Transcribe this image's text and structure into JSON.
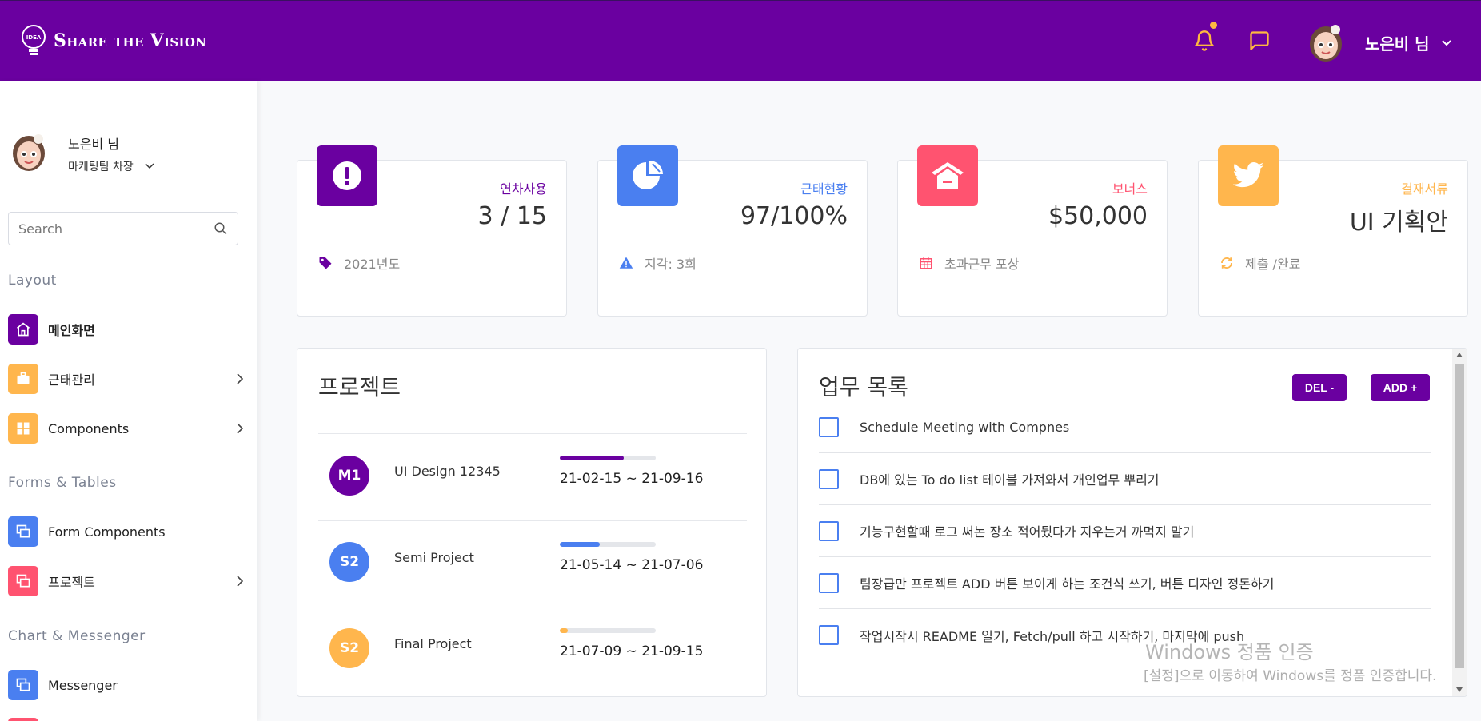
{
  "header": {
    "logo_text": "Share the Vision",
    "logo_badge": "IDEA",
    "user_name": "노은비 님"
  },
  "sidebar": {
    "user_name": "노은비 님",
    "user_role": "마케팅팀 차장",
    "search_placeholder": "Search",
    "sections": {
      "layout": "Layout",
      "forms": "Forms & Tables",
      "chart": "Chart & Messenger"
    },
    "items": [
      {
        "label": "메인화면",
        "icon": "home-icon",
        "color": "#6a00a0"
      },
      {
        "label": "근태관리",
        "icon": "briefcase-icon",
        "color": "#ffb64d"
      },
      {
        "label": "Components",
        "icon": "grid-icon",
        "color": "#ffb64d"
      },
      {
        "label": "Form Components",
        "icon": "windows-icon",
        "color": "#4a7ff0"
      },
      {
        "label": "프로젝트",
        "icon": "windows-icon",
        "color": "#ff5370"
      },
      {
        "label": "Messenger",
        "icon": "windows-icon",
        "color": "#4a7ff0"
      }
    ]
  },
  "stats": [
    {
      "label": "연차사용",
      "value": "3 / 15",
      "foot": "2021년도",
      "color": "#6a00a0",
      "icon": "exclamation-icon",
      "foot_icon": "tag-icon"
    },
    {
      "label": "근태현황",
      "value": "97/100%",
      "foot": "지각: 3회",
      "color": "#4a7ff0",
      "icon": "pie-chart-icon",
      "foot_icon": "warning-icon"
    },
    {
      "label": "보너스",
      "value": "$50,000",
      "foot": "초과근무 포상",
      "color": "#ff5370",
      "icon": "home-icon",
      "foot_icon": "calendar-icon"
    },
    {
      "label": "결재서류",
      "value": "UI 기획안",
      "foot": "제출 /완료",
      "color": "#ffb64d",
      "icon": "twitter-icon",
      "foot_icon": "refresh-icon"
    }
  ],
  "projects": {
    "title": "프로젝트",
    "rows": [
      {
        "badge": "M1",
        "name": "UI Design 12345",
        "dates": "21-02-15 ~ 21-09-16",
        "progress": 0.67,
        "color": "#6a00a0"
      },
      {
        "badge": "S2",
        "name": "Semi Project",
        "dates": "21-05-14 ~ 21-07-06",
        "progress": 0.42,
        "color": "#4a7ff0"
      },
      {
        "badge": "S2",
        "name": "Final Project",
        "dates": "21-07-09 ~ 21-09-15",
        "progress": 0.08,
        "color": "#ffb64d"
      }
    ]
  },
  "tasks": {
    "title": "업무 목록",
    "del_label": "DEL -",
    "add_label": "ADD +",
    "items": [
      "Schedule Meeting with Compnes",
      "DB에 있는 To do list 테이블 가져와서 개인업무 뿌리기",
      "기능구현할때 로그 써논 장소 적어뒀다가 지우는거 까먹지 말기",
      "팀장급만 프로젝트 ADD 버튼 보이게 하는 조건식 쓰기, 버튼 디자인 정돈하기",
      "작업시작시 README 일기, Fetch/pull 하고 시작하기, 마지막에 push"
    ]
  },
  "watermark": {
    "line1": "Windows 정품 인증",
    "line2": "[설정]으로 이동하여 Windows를 정품 인증합니다."
  }
}
